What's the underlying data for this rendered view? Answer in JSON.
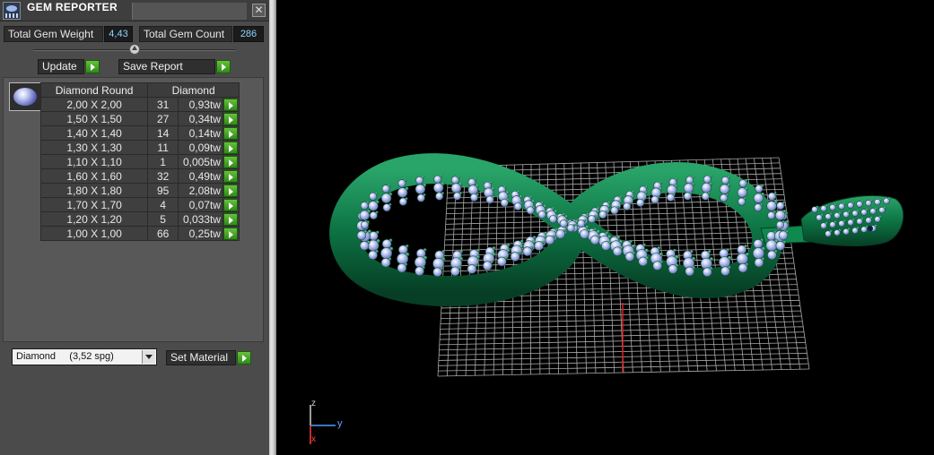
{
  "window": {
    "title": "GEM REPORTER",
    "close_label": "✕"
  },
  "stats": {
    "total_weight_label": "Total Gem Weight",
    "total_weight_value": "4,43",
    "total_count_label": "Total Gem Count",
    "total_count_value": "286"
  },
  "actions": {
    "update_label": "Update",
    "save_report_label": "Save Report"
  },
  "table": {
    "headers": [
      "Diamond Round",
      "Diamond"
    ],
    "rows": [
      {
        "size": "2,00 X 2,00",
        "count": "31",
        "weight": "0,93tw"
      },
      {
        "size": "1,50 X 1,50",
        "count": "27",
        "weight": "0,34tw"
      },
      {
        "size": "1,40 X 1,40",
        "count": "14",
        "weight": "0,14tw"
      },
      {
        "size": "1,30 X 1,30",
        "count": "11",
        "weight": "0,09tw"
      },
      {
        "size": "1,10 X 1,10",
        "count": "1",
        "weight": "0,005tw"
      },
      {
        "size": "1,60 X 1,60",
        "count": "32",
        "weight": "0,49tw"
      },
      {
        "size": "1,80 X 1,80",
        "count": "95",
        "weight": "2,08tw"
      },
      {
        "size": "1,70 X 1,70",
        "count": "4",
        "weight": "0,07tw"
      },
      {
        "size": "1,20 X 1,20",
        "count": "5",
        "weight": "0,033tw"
      },
      {
        "size": "1,00 X 1,00",
        "count": "66",
        "weight": "0,25tw"
      }
    ]
  },
  "material": {
    "selected": "Diamond     (3,52 spg)",
    "set_label": "Set Material"
  },
  "axes": {
    "z": "z",
    "y": "y",
    "x": "x"
  },
  "colors": {
    "metal": "#0b6b3e",
    "gem": "#a9b7f0",
    "accent_button": "#4caf2a",
    "grid": "#b5b5b5"
  }
}
